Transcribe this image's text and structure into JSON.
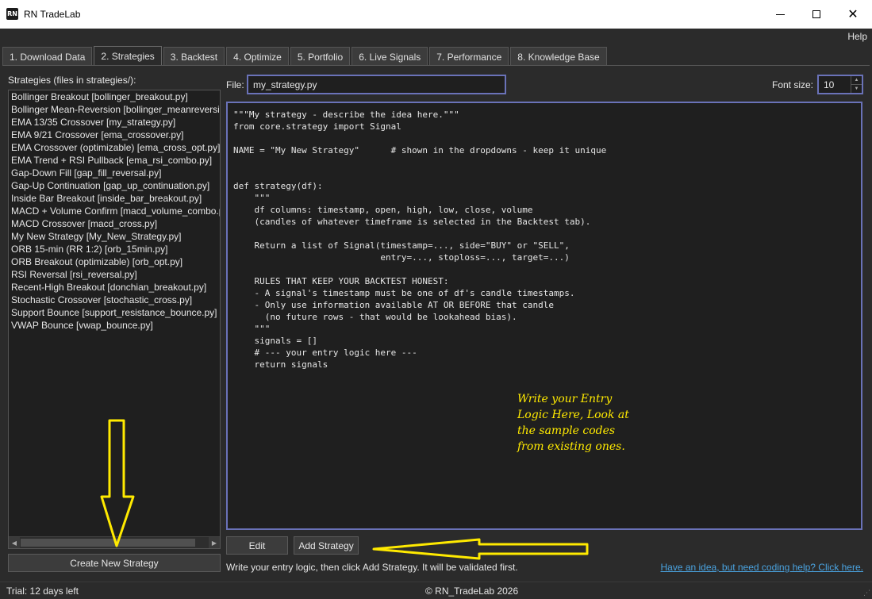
{
  "window": {
    "logo_text": "RN",
    "title": "RN TradeLab",
    "close_glyph": "✕"
  },
  "menu": {
    "help": "Help"
  },
  "tabs": [
    {
      "label": "1. Download Data",
      "active": false
    },
    {
      "label": "2. Strategies",
      "active": true
    },
    {
      "label": "3. Backtest",
      "active": false
    },
    {
      "label": "4. Optimize",
      "active": false
    },
    {
      "label": "5. Portfolio",
      "active": false
    },
    {
      "label": "6. Live Signals",
      "active": false
    },
    {
      "label": "7. Performance",
      "active": false
    },
    {
      "label": "8. Knowledge Base",
      "active": false
    }
  ],
  "strategies": {
    "label": "Strategies (files in strategies/):",
    "items": [
      "Bollinger Breakout  [bollinger_breakout.py]",
      "Bollinger Mean-Reversion  [bollinger_meanreversion.py]",
      "EMA 13/35 Crossover  [my_strategy.py]",
      "EMA 9/21 Crossover  [ema_crossover.py]",
      "EMA Crossover (optimizable)  [ema_cross_opt.py]",
      "EMA Trend + RSI Pullback  [ema_rsi_combo.py]",
      "Gap-Down Fill  [gap_fill_reversal.py]",
      "Gap-Up Continuation  [gap_up_continuation.py]",
      "Inside Bar Breakout  [inside_bar_breakout.py]",
      "MACD + Volume Confirm  [macd_volume_combo.py]",
      "MACD Crossover  [macd_cross.py]",
      "My New Strategy  [My_New_Strategy.py]",
      "ORB 15-min (RR 1:2)  [orb_15min.py]",
      "ORB Breakout (optimizable)  [orb_opt.py]",
      "RSI Reversal  [rsi_reversal.py]",
      "Recent-High Breakout  [donchian_breakout.py]",
      "Stochastic Crossover  [stochastic_cross.py]",
      "Support Bounce  [support_resistance_bounce.py]",
      "VWAP Bounce  [vwap_bounce.py]"
    ],
    "scroll_left": "◀",
    "scroll_right": "▶",
    "create_button": "Create New Strategy"
  },
  "editor": {
    "file_label": "File:",
    "file_value": "my_strategy.py",
    "font_size_label": "Font size:",
    "font_size_value": "10",
    "spin_up": "▲",
    "spin_down": "▼",
    "code": "\"\"\"My strategy - describe the idea here.\"\"\"\nfrom core.strategy import Signal\n\nNAME = \"My New Strategy\"      # shown in the dropdowns - keep it unique\n\n\ndef strategy(df):\n    \"\"\"\n    df columns: timestamp, open, high, low, close, volume\n    (candles of whatever timeframe is selected in the Backtest tab).\n\n    Return a list of Signal(timestamp=..., side=\"BUY\" or \"SELL\",\n                            entry=..., stoploss=..., target=...)\n\n    RULES THAT KEEP YOUR BACKTEST HONEST:\n    - A signal's timestamp must be one of df's candle timestamps.\n    - Only use information available AT OR BEFORE that candle\n      (no future rows - that would be lookahead bias).\n    \"\"\"\n    signals = []\n    # --- your entry logic here ---\n    return signals",
    "edit_button": "Edit",
    "add_button": "Add Strategy",
    "hint": "Write your entry logic, then click Add Strategy. It will be validated first.",
    "help_link": "Have an idea, but need coding help? Click here."
  },
  "status": {
    "trial": "Trial: 12 days left",
    "copyright": "© RN_TradeLab 2026",
    "grip": "⋰"
  },
  "annotation": {
    "lines": [
      "Write your Entry",
      "Logic Here, Look at",
      "the sample codes",
      "from existing ones."
    ],
    "color": "#ffea00"
  }
}
